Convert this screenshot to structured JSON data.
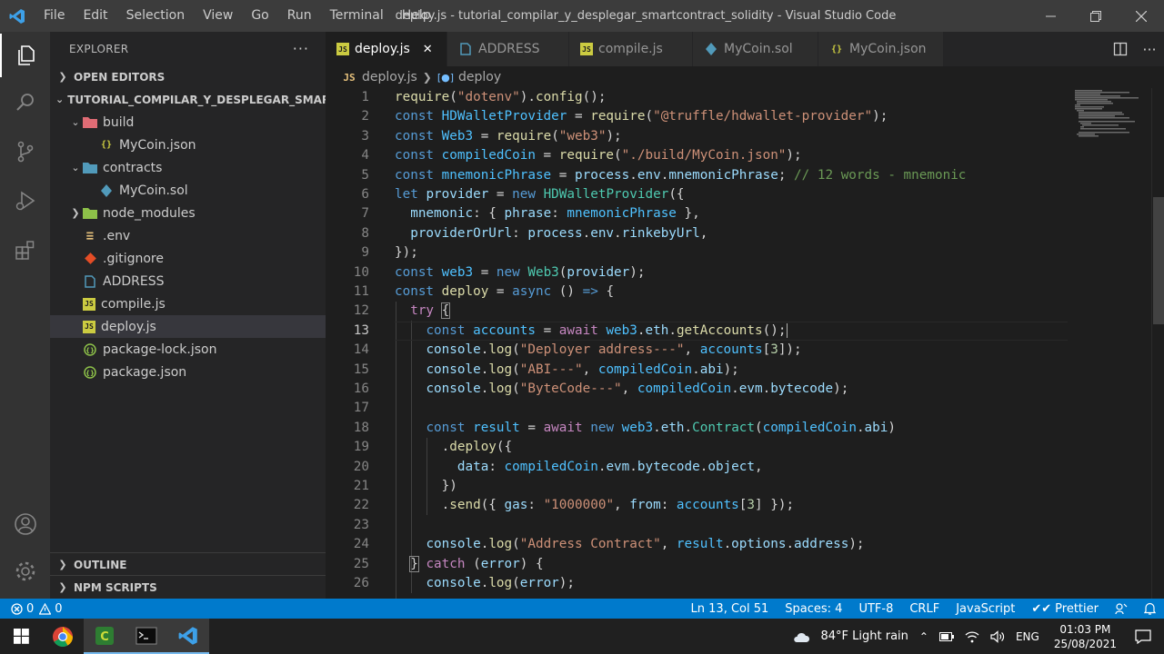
{
  "window": {
    "title": "deploy.js - tutorial_compilar_y_desplegar_smartcontract_solidity - Visual Studio Code",
    "menu": [
      "File",
      "Edit",
      "Selection",
      "View",
      "Go",
      "Run",
      "Terminal",
      "Help"
    ]
  },
  "sidebar": {
    "title": "EXPLORER",
    "open_editors": "OPEN EDITORS",
    "project": "TUTORIAL_COMPILAR_Y_DESPLEGAR_SMARTC...",
    "tree": [
      {
        "label": "build",
        "icon": "folder-build-icon",
        "indent": 1,
        "chev": "v"
      },
      {
        "label": "MyCoin.json",
        "icon": "json-file-icon",
        "indent": 2,
        "chev": ""
      },
      {
        "label": "contracts",
        "icon": "folder-contracts-icon",
        "indent": 1,
        "chev": "v"
      },
      {
        "label": "MyCoin.sol",
        "icon": "solidity-file-icon",
        "indent": 2,
        "chev": ""
      },
      {
        "label": "node_modules",
        "icon": "folder-node-icon",
        "indent": 1,
        "chev": ">"
      },
      {
        "label": ".env",
        "icon": "env-file-icon",
        "indent": 1,
        "chev": ""
      },
      {
        "label": ".gitignore",
        "icon": "git-file-icon",
        "indent": 1,
        "chev": ""
      },
      {
        "label": "ADDRESS",
        "icon": "plain-file-icon",
        "indent": 1,
        "chev": ""
      },
      {
        "label": "compile.js",
        "icon": "js-file-icon",
        "indent": 1,
        "chev": ""
      },
      {
        "label": "deploy.js",
        "icon": "js-file-icon",
        "indent": 1,
        "chev": "",
        "selected": true
      },
      {
        "label": "package-lock.json",
        "icon": "npm-json-icon",
        "indent": 1,
        "chev": ""
      },
      {
        "label": "package.json",
        "icon": "npm-json-icon",
        "indent": 1,
        "chev": ""
      }
    ],
    "outline": "OUTLINE",
    "npm_scripts": "NPM SCRIPTS"
  },
  "tabs": [
    {
      "label": "deploy.js",
      "icon": "js-file-icon",
      "active": true
    },
    {
      "label": "ADDRESS",
      "icon": "plain-file-icon"
    },
    {
      "label": "compile.js",
      "icon": "js-file-icon"
    },
    {
      "label": "MyCoin.sol",
      "icon": "solidity-file-icon"
    },
    {
      "label": "MyCoin.json",
      "icon": "json-file-icon"
    }
  ],
  "breadcrumb": {
    "file": "deploy.js",
    "symbol": "deploy"
  },
  "editor": {
    "current_line": 13,
    "lines": [
      [
        [
          "f",
          "require"
        ],
        [
          "p",
          "("
        ],
        [
          "s",
          "\"dotenv\""
        ],
        [
          "p",
          ")."
        ],
        [
          "f",
          "config"
        ],
        [
          "p",
          "();"
        ]
      ],
      [
        [
          "k",
          "const "
        ],
        [
          "cn",
          "HDWalletProvider"
        ],
        [
          "p",
          " = "
        ],
        [
          "f",
          "require"
        ],
        [
          "p",
          "("
        ],
        [
          "s",
          "\"@truffle/hdwallet-provider\""
        ],
        [
          "p",
          ");"
        ]
      ],
      [
        [
          "k",
          "const "
        ],
        [
          "cn",
          "Web3"
        ],
        [
          "p",
          " = "
        ],
        [
          "f",
          "require"
        ],
        [
          "p",
          "("
        ],
        [
          "s",
          "\"web3\""
        ],
        [
          "p",
          ");"
        ]
      ],
      [
        [
          "k",
          "const "
        ],
        [
          "cn",
          "compiledCoin"
        ],
        [
          "p",
          " = "
        ],
        [
          "f",
          "require"
        ],
        [
          "p",
          "("
        ],
        [
          "s",
          "\"./build/MyCoin.json\""
        ],
        [
          "p",
          ");"
        ]
      ],
      [
        [
          "k",
          "const "
        ],
        [
          "cn",
          "mnemonicPhrase"
        ],
        [
          "p",
          " = "
        ],
        [
          "v",
          "process"
        ],
        [
          "p",
          "."
        ],
        [
          "v",
          "env"
        ],
        [
          "p",
          "."
        ],
        [
          "v",
          "mnemonicPhrase"
        ],
        [
          "p",
          "; "
        ],
        [
          "cm",
          "// 12 words - mnemonic"
        ]
      ],
      [
        [
          "k",
          "let "
        ],
        [
          "v",
          "provider"
        ],
        [
          "p",
          " = "
        ],
        [
          "k",
          "new "
        ],
        [
          "t",
          "HDWalletProvider"
        ],
        [
          "p",
          "({"
        ]
      ],
      [
        [
          "p",
          "  "
        ],
        [
          "v",
          "mnemonic"
        ],
        [
          "p",
          ": { "
        ],
        [
          "v",
          "phrase"
        ],
        [
          "p",
          ": "
        ],
        [
          "cn",
          "mnemonicPhrase"
        ],
        [
          "p",
          " },"
        ]
      ],
      [
        [
          "p",
          "  "
        ],
        [
          "v",
          "providerOrUrl"
        ],
        [
          "p",
          ": "
        ],
        [
          "v",
          "process"
        ],
        [
          "p",
          "."
        ],
        [
          "v",
          "env"
        ],
        [
          "p",
          "."
        ],
        [
          "v",
          "rinkebyUrl"
        ],
        [
          "p",
          ","
        ]
      ],
      [
        [
          "p",
          "});"
        ]
      ],
      [
        [
          "k",
          "const "
        ],
        [
          "cn",
          "web3"
        ],
        [
          "p",
          " = "
        ],
        [
          "k",
          "new "
        ],
        [
          "t",
          "Web3"
        ],
        [
          "p",
          "("
        ],
        [
          "v",
          "provider"
        ],
        [
          "p",
          ");"
        ]
      ],
      [
        [
          "k",
          "const "
        ],
        [
          "f",
          "deploy"
        ],
        [
          "p",
          " = "
        ],
        [
          "k",
          "async"
        ],
        [
          "p",
          " () "
        ],
        [
          "k",
          "=>"
        ],
        [
          "p",
          " {"
        ]
      ],
      [
        [
          "p",
          "  "
        ],
        [
          "c",
          "try"
        ],
        [
          "p",
          " "
        ],
        [
          "br",
          "{"
        ]
      ],
      [
        [
          "p",
          "    "
        ],
        [
          "k",
          "const "
        ],
        [
          "cn",
          "accounts"
        ],
        [
          "p",
          " = "
        ],
        [
          "c",
          "await "
        ],
        [
          "cn",
          "web3"
        ],
        [
          "p",
          "."
        ],
        [
          "v",
          "eth"
        ],
        [
          "p",
          "."
        ],
        [
          "f",
          "getAccounts"
        ],
        [
          "p",
          "();"
        ]
      ],
      [
        [
          "p",
          "    "
        ],
        [
          "v",
          "console"
        ],
        [
          "p",
          "."
        ],
        [
          "f",
          "log"
        ],
        [
          "p",
          "("
        ],
        [
          "s",
          "\"Deployer address---\""
        ],
        [
          "p",
          ", "
        ],
        [
          "cn",
          "accounts"
        ],
        [
          "p",
          "["
        ],
        [
          "n",
          "3"
        ],
        [
          "p",
          "]);"
        ]
      ],
      [
        [
          "p",
          "    "
        ],
        [
          "v",
          "console"
        ],
        [
          "p",
          "."
        ],
        [
          "f",
          "log"
        ],
        [
          "p",
          "("
        ],
        [
          "s",
          "\"ABI---\""
        ],
        [
          "p",
          ", "
        ],
        [
          "cn",
          "compiledCoin"
        ],
        [
          "p",
          "."
        ],
        [
          "v",
          "abi"
        ],
        [
          "p",
          ");"
        ]
      ],
      [
        [
          "p",
          "    "
        ],
        [
          "v",
          "console"
        ],
        [
          "p",
          "."
        ],
        [
          "f",
          "log"
        ],
        [
          "p",
          "("
        ],
        [
          "s",
          "\"ByteCode---\""
        ],
        [
          "p",
          ", "
        ],
        [
          "cn",
          "compiledCoin"
        ],
        [
          "p",
          "."
        ],
        [
          "v",
          "evm"
        ],
        [
          "p",
          "."
        ],
        [
          "v",
          "bytecode"
        ],
        [
          "p",
          ");"
        ]
      ],
      [],
      [
        [
          "p",
          "    "
        ],
        [
          "k",
          "const "
        ],
        [
          "cn",
          "result"
        ],
        [
          "p",
          " = "
        ],
        [
          "c",
          "await "
        ],
        [
          "k",
          "new "
        ],
        [
          "cn",
          "web3"
        ],
        [
          "p",
          "."
        ],
        [
          "v",
          "eth"
        ],
        [
          "p",
          "."
        ],
        [
          "t",
          "Contract"
        ],
        [
          "p",
          "("
        ],
        [
          "cn",
          "compiledCoin"
        ],
        [
          "p",
          "."
        ],
        [
          "v",
          "abi"
        ],
        [
          "p",
          ")"
        ]
      ],
      [
        [
          "p",
          "      ."
        ],
        [
          "f",
          "deploy"
        ],
        [
          "p",
          "({"
        ]
      ],
      [
        [
          "p",
          "        "
        ],
        [
          "v",
          "data"
        ],
        [
          "p",
          ": "
        ],
        [
          "cn",
          "compiledCoin"
        ],
        [
          "p",
          "."
        ],
        [
          "v",
          "evm"
        ],
        [
          "p",
          "."
        ],
        [
          "v",
          "bytecode"
        ],
        [
          "p",
          "."
        ],
        [
          "v",
          "object"
        ],
        [
          "p",
          ","
        ]
      ],
      [
        [
          "p",
          "      })"
        ]
      ],
      [
        [
          "p",
          "      ."
        ],
        [
          "f",
          "send"
        ],
        [
          "p",
          "({ "
        ],
        [
          "v",
          "gas"
        ],
        [
          "p",
          ": "
        ],
        [
          "s",
          "\"1000000\""
        ],
        [
          "p",
          ", "
        ],
        [
          "v",
          "from"
        ],
        [
          "p",
          ": "
        ],
        [
          "cn",
          "accounts"
        ],
        [
          "p",
          "["
        ],
        [
          "n",
          "3"
        ],
        [
          "p",
          "] });"
        ]
      ],
      [],
      [
        [
          "p",
          "    "
        ],
        [
          "v",
          "console"
        ],
        [
          "p",
          "."
        ],
        [
          "f",
          "log"
        ],
        [
          "p",
          "("
        ],
        [
          "s",
          "\"Address Contract\""
        ],
        [
          "p",
          ", "
        ],
        [
          "cn",
          "result"
        ],
        [
          "p",
          "."
        ],
        [
          "v",
          "options"
        ],
        [
          "p",
          "."
        ],
        [
          "v",
          "address"
        ],
        [
          "p",
          ");"
        ]
      ],
      [
        [
          "p",
          "  "
        ],
        [
          "br",
          "}"
        ],
        [
          "p",
          " "
        ],
        [
          "c",
          "catch"
        ],
        [
          "p",
          " ("
        ],
        [
          "v",
          "error"
        ],
        [
          "p",
          ") {"
        ]
      ],
      [
        [
          "p",
          "    "
        ],
        [
          "v",
          "console"
        ],
        [
          "p",
          "."
        ],
        [
          "f",
          "log"
        ],
        [
          "p",
          "("
        ],
        [
          "v",
          "error"
        ],
        [
          "p",
          ");"
        ]
      ]
    ]
  },
  "status": {
    "errors": "0",
    "warnings": "0",
    "position": "Ln 13, Col 51",
    "spaces": "Spaces: 4",
    "encoding": "UTF-8",
    "eol": "CRLF",
    "language": "JavaScript",
    "prettier": "Prettier"
  },
  "taskbar": {
    "weather": "84°F  Light rain",
    "language": "ENG",
    "time": "01:03 PM",
    "date": "25/08/2021"
  }
}
